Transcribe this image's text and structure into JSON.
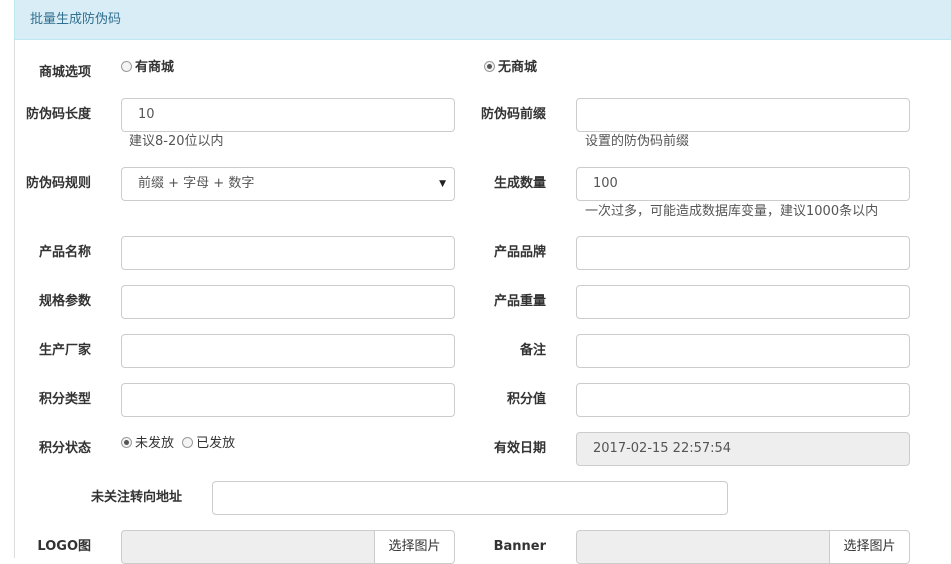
{
  "panel": {
    "title": "批量生成防伪码"
  },
  "mall_option": {
    "label": "商城选项",
    "options": [
      {
        "label": "有商城",
        "checked": false
      },
      {
        "label": "无商城",
        "checked": true
      }
    ]
  },
  "code_length": {
    "label": "防伪码长度",
    "value": "10",
    "help": "建议8-20位以内"
  },
  "code_prefix": {
    "label": "防伪码前缀",
    "value": "",
    "help": "设置的防伪码前缀"
  },
  "code_rule": {
    "label": "防伪码规则",
    "selected": "前缀 + 字母 + 数字"
  },
  "quantity": {
    "label": "生成数量",
    "value": "100",
    "help": "一次过多，可能造成数据库变量，建议1000条以内"
  },
  "product_name": {
    "label": "产品名称",
    "value": ""
  },
  "product_brand": {
    "label": "产品品牌",
    "value": ""
  },
  "spec": {
    "label": "规格参数",
    "value": ""
  },
  "weight": {
    "label": "产品重量",
    "value": ""
  },
  "manufacturer": {
    "label": "生产厂家",
    "value": ""
  },
  "remark": {
    "label": "备注",
    "value": ""
  },
  "points_type": {
    "label": "积分类型",
    "value": ""
  },
  "points_value": {
    "label": "积分值",
    "value": ""
  },
  "points_status": {
    "label": "积分状态",
    "options": [
      {
        "label": "未发放",
        "checked": true
      },
      {
        "label": "已发放",
        "checked": false
      }
    ]
  },
  "expiry": {
    "label": "有效日期",
    "value": "2017-02-15 22:57:54"
  },
  "redirect_url": {
    "label": "未关注转向地址",
    "value": ""
  },
  "logo": {
    "label": "LOGO图",
    "button": "选择图片"
  },
  "banner": {
    "label": "Banner",
    "button": "选择图片"
  }
}
